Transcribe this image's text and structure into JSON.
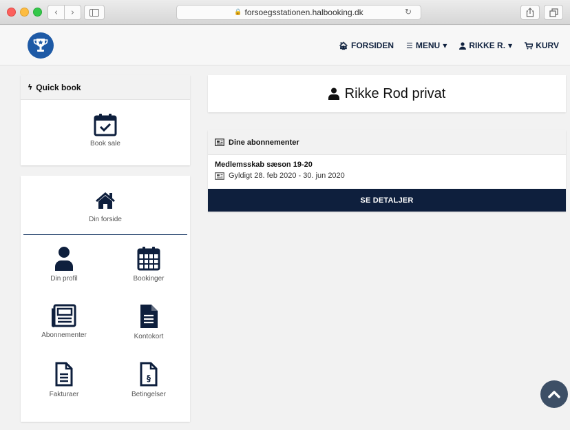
{
  "browser": {
    "url": "forsoegsstationen.halbooking.dk"
  },
  "nav": {
    "home": "FORSIDEN",
    "menu": "MENU",
    "user": "RIKKE R.",
    "cart": "KURV"
  },
  "quick_book": {
    "title": "Quick book",
    "item_label": "Book sale"
  },
  "dashboard": {
    "home_label": "Din forside",
    "tiles": [
      {
        "label": "Din profil"
      },
      {
        "label": "Bookinger"
      },
      {
        "label": "Abonnementer"
      },
      {
        "label": "Kontokort"
      },
      {
        "label": "Fakturaer"
      },
      {
        "label": "Betingelser"
      }
    ]
  },
  "profile": {
    "name": "Rikke Rod privat"
  },
  "subscriptions": {
    "header": "Dine abonnementer",
    "item_title": "Medlemsskab sæson 19-20",
    "validity": "Gyldigt 28. feb 2020 - 30. jun 2020",
    "details_button": "SE DETALJER"
  },
  "colors": {
    "navy": "#0e1f3d",
    "brand_blue": "#1e5aa6",
    "scroll_top": "#3d4f66"
  }
}
